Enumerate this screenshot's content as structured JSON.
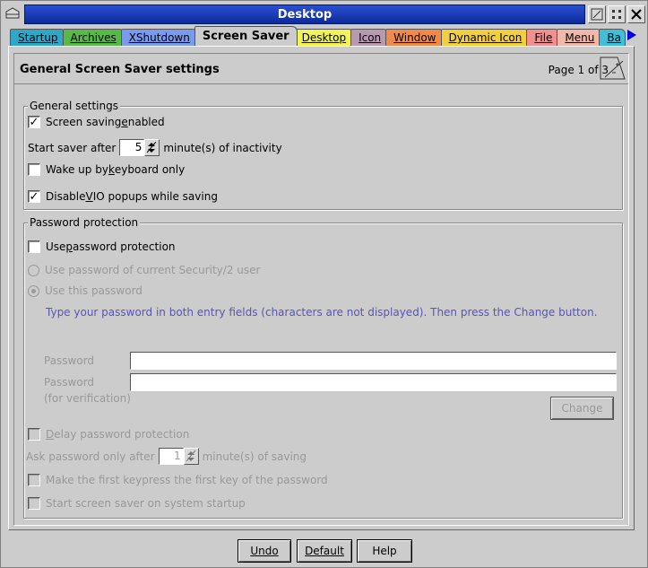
{
  "window": {
    "title": "Desktop"
  },
  "tabs": [
    {
      "label": "Startup",
      "color": "#2fa8c8"
    },
    {
      "label": "Archives",
      "color": "#58b848"
    },
    {
      "label": "XShutdown",
      "color": "#7a9aee"
    },
    {
      "label": "Screen Saver",
      "color": "#cccccc",
      "active": true
    },
    {
      "label": "Desktop",
      "color": "#f2f25a"
    },
    {
      "label": "Icon",
      "color": "#b89ab0"
    },
    {
      "label": "Window",
      "color": "#f08a48"
    },
    {
      "label": "Dynamic Icon",
      "color": "#f0d040"
    },
    {
      "label": "File",
      "color": "#f09090"
    },
    {
      "label": "Menu",
      "color": "#f0b8a8"
    },
    {
      "label": "Ba",
      "color": "#40c0d8"
    }
  ],
  "page": {
    "title": "General Screen Saver settings",
    "page_indicator": "Page 1 of 3"
  },
  "general": {
    "group_title": "General settings",
    "screen_saving_enabled": {
      "label_pre": "Screen saving ",
      "label_u": "e",
      "label_post": "nabled",
      "checked": true
    },
    "start_after": {
      "label": "Start saver after",
      "value": "5",
      "suffix": "minute(s) of inactivity"
    },
    "wake_keyboard": {
      "label_pre": "Wake up by ",
      "label_u": "k",
      "label_post": "eyboard only",
      "checked": false
    },
    "disable_vio": {
      "label_pre": "Disable ",
      "label_u": "V",
      "label_post": "IO popups while saving",
      "checked": true
    }
  },
  "password": {
    "group_title": "Password protection",
    "use_protection": {
      "label_pre": "Use ",
      "label_u": "p",
      "label_post": "assword protection",
      "checked": false
    },
    "radio_security": {
      "label": "Use password of current Security/2 user",
      "selected": false
    },
    "radio_this": {
      "label": "Use this password",
      "selected": true
    },
    "note": "Type your password in both entry fields (characters are not displayed). Then press the Change button.",
    "password_label": "Password",
    "password2_label": "Password",
    "password2_sub": "(for verification)",
    "password_value": "",
    "password2_value": "",
    "change_button": "Change",
    "delay": {
      "label_pre": "",
      "label_u": "D",
      "label_post": "elay password protection",
      "checked": false
    },
    "ask_after": {
      "label": "Ask password only after",
      "value": "1",
      "suffix": "minute(s) of saving"
    },
    "first_keypress": {
      "label": "Make the first keypress the first key of the password",
      "checked": false
    },
    "start_on_startup": {
      "label": "Start screen saver on system startup",
      "checked": false
    }
  },
  "buttons": {
    "undo": "Undo",
    "default": "Default",
    "help": "Help"
  }
}
